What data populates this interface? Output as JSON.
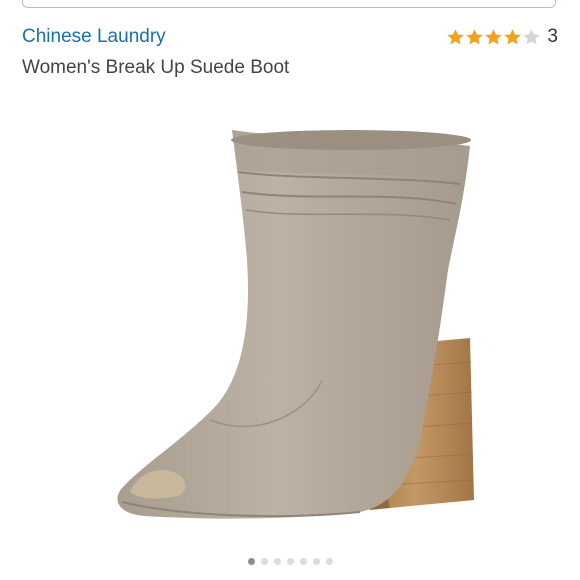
{
  "product": {
    "brand": "Chinese Laundry",
    "title": "Women's Break Up Suede Boot"
  },
  "rating": {
    "stars": 4,
    "max_stars": 5,
    "count": "3",
    "star_color": "#f0a41e",
    "empty_star_color": "#d6d6d6"
  },
  "image": {
    "icon": "suede-peep-toe-boot-image",
    "boot_color": "#b5aa9c",
    "heel_color": "#b58a57"
  },
  "carousel": {
    "total": 7,
    "active_index": 0
  },
  "colors": {
    "brand_link": "#1d6fa5",
    "title_text": "#444444"
  }
}
